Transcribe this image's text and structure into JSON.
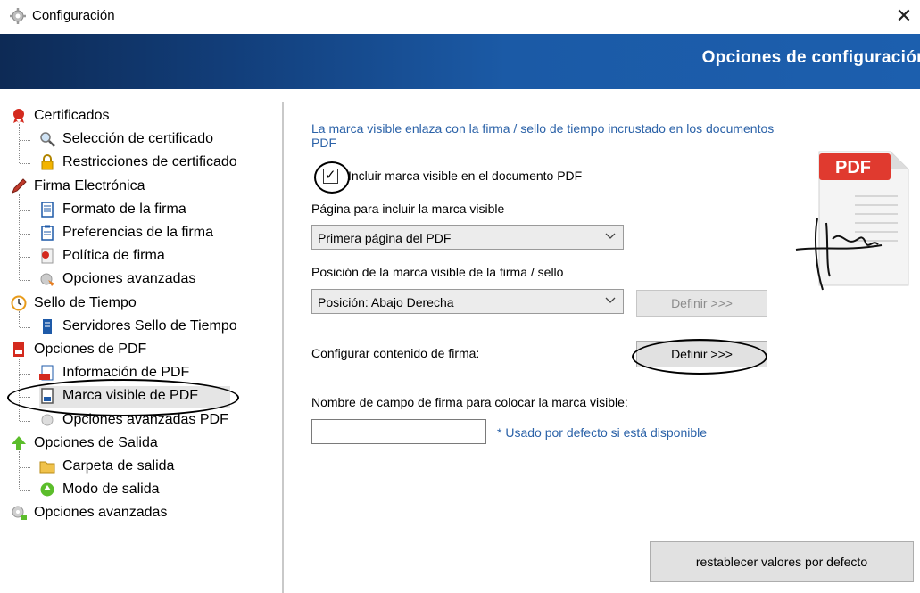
{
  "window": {
    "title": "Configuración",
    "close_glyph": "✕",
    "icon": "gear-icon"
  },
  "banner": {
    "title": "Opciones de configuración"
  },
  "sidebar": {
    "items": [
      {
        "label": "Certificados",
        "icon": "certificate-ribbon-icon",
        "level": 0
      },
      {
        "label": "Selección de certificado",
        "icon": "magnifier-icon",
        "level": 1
      },
      {
        "label": "Restricciones de certificado",
        "icon": "lock-icon",
        "level": 1
      },
      {
        "label": "Firma Electrónica",
        "icon": "pen-icon",
        "level": 0
      },
      {
        "label": "Formato de la firma",
        "icon": "document-icon",
        "level": 1
      },
      {
        "label": "Preferencias de la firma",
        "icon": "clipboard-icon",
        "level": 1
      },
      {
        "label": "Política de firma",
        "icon": "policy-document-icon",
        "level": 1
      },
      {
        "label": "Opciones avanzadas",
        "icon": "advanced-settings-icon",
        "level": 1
      },
      {
        "label": "Sello de Tiempo",
        "icon": "clock-icon",
        "level": 0
      },
      {
        "label": "Servidores Sello de Tiempo",
        "icon": "server-icon",
        "level": 1
      },
      {
        "label": "Opciones de PDF",
        "icon": "pdf-file-icon",
        "level": 0
      },
      {
        "label": "Información de PDF",
        "icon": "pdf-info-icon",
        "level": 1
      },
      {
        "label": "Marca visible de PDF",
        "icon": "pdf-visible-mark-icon",
        "level": 1,
        "selected": true
      },
      {
        "label": "Opciones avanzadas PDF",
        "icon": "pdf-advanced-icon",
        "level": 1
      },
      {
        "label": "Opciones de Salida",
        "icon": "green-up-arrow-icon",
        "level": 0
      },
      {
        "label": "Carpeta de salida",
        "icon": "folder-icon",
        "level": 1
      },
      {
        "label": "Modo de salida",
        "icon": "green-circle-icon",
        "level": 1
      },
      {
        "label": "Opciones avanzadas",
        "icon": "gear-plus-icon",
        "level": 0
      }
    ]
  },
  "main": {
    "info_text": "La marca visible enlaza con la firma / sello de tiempo incrustado en los documentos PDF",
    "include_checkbox": {
      "label": "Incluir marca visible en el documento PDF",
      "checked": true,
      "check_glyph": "✓"
    },
    "page_label": "Página para incluir la marca visible",
    "page_select": {
      "value": "Primera página del PDF"
    },
    "position_label": "Posición de la marca visible de la firma / sello",
    "position_select": {
      "value": "Posición: Abajo Derecha"
    },
    "position_define_button": {
      "label": "Definir >>>",
      "enabled": false
    },
    "content_label": "Configurar contenido de firma:",
    "content_define_button": {
      "label": "Definir >>>",
      "enabled": true
    },
    "field_name_label": "Nombre de campo de firma para colocar la marca visible:",
    "field_name_input": {
      "value": ""
    },
    "field_name_hint": "* Usado por defecto si está disponible",
    "reset_button": {
      "label": "restablecer valores por defecto"
    },
    "pdf_badge": "PDF"
  },
  "colors": {
    "banner": "#1b5aa6",
    "info_text": "#2b62a8",
    "pdf_red": "#e03a2f"
  }
}
